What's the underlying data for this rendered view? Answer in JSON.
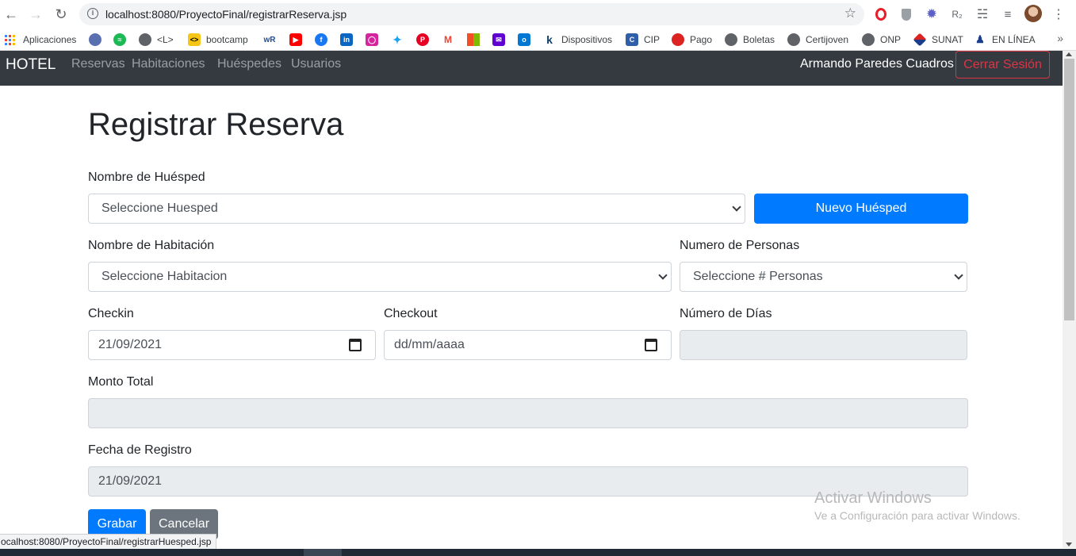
{
  "browser": {
    "url": "localhost:8080/ProyectoFinal/registrarReserva.jsp",
    "bookmarks": [
      {
        "label": "Aplicaciones",
        "icon": "apps-icon"
      },
      {
        "label": "",
        "icon": "globe-icon"
      },
      {
        "label": "",
        "icon": "spotify-icon"
      },
      {
        "label": "<L>",
        "icon": "globe-icon"
      },
      {
        "label": "bootcamp",
        "icon": "bootcamp-icon"
      },
      {
        "label": "",
        "icon": "wordreference-icon"
      },
      {
        "label": "",
        "icon": "youtube-icon"
      },
      {
        "label": "",
        "icon": "facebook-icon"
      },
      {
        "label": "",
        "icon": "linkedin-icon"
      },
      {
        "label": "",
        "icon": "instagram-icon"
      },
      {
        "label": "",
        "icon": "twitter-icon"
      },
      {
        "label": "",
        "icon": "pinterest-icon"
      },
      {
        "label": "",
        "icon": "gmail-icon"
      },
      {
        "label": "",
        "icon": "microsoft-icon"
      },
      {
        "label": "",
        "icon": "yahoo-mail-icon"
      },
      {
        "label": "",
        "icon": "outlook-icon"
      },
      {
        "label": "Dispositivos",
        "icon": "k-icon"
      },
      {
        "label": "CIP",
        "icon": "cip-icon"
      },
      {
        "label": "Pago",
        "icon": "pago-icon"
      },
      {
        "label": "Boletas",
        "icon": "globe-icon"
      },
      {
        "label": "Certijoven",
        "icon": "globe-icon"
      },
      {
        "label": "ONP",
        "icon": "globe-icon"
      },
      {
        "label": "SUNAT",
        "icon": "sunat-icon"
      },
      {
        "label": "EN LÍNEA",
        "icon": "people-icon"
      }
    ],
    "status_url": "ocalhost:8080/ProyectoFinal/registrarHuesped.jsp"
  },
  "navbar": {
    "brand": "HOTEL",
    "links": [
      "Reservas",
      "Habitaciones",
      "Huéspedes",
      "Usuarios"
    ],
    "user": "Armando Paredes Cuadros",
    "logout": "Cerrar Sesión"
  },
  "form": {
    "title": "Registrar Reserva",
    "guest_label": "Nombre de Huésped",
    "guest_value": "Seleccione Huesped",
    "new_guest_button": "Nuevo Huésped",
    "room_label": "Nombre de Habitación",
    "room_value": "Seleccione Habitacion",
    "persons_label": "Numero de Personas",
    "persons_value": "Seleccione # Personas",
    "checkin_label": "Checkin",
    "checkin_value": "21/09/2021",
    "checkout_label": "Checkout",
    "checkout_value": "dd/mm/aaaa",
    "days_label": "Número de Días",
    "days_value": "",
    "total_label": "Monto Total",
    "total_value": "",
    "reg_date_label": "Fecha de Registro",
    "reg_date_value": "21/09/2021",
    "save_button": "Grabar",
    "cancel_button": "Cancelar"
  },
  "watermark": {
    "line1": "Activar Windows",
    "line2": "Ve a Configuración para activar Windows."
  },
  "colors": {
    "navbar_bg": "#343a40",
    "primary": "#007bff",
    "secondary": "#6c757d",
    "danger": "#dc3545",
    "readonly_bg": "#e9ecef"
  }
}
